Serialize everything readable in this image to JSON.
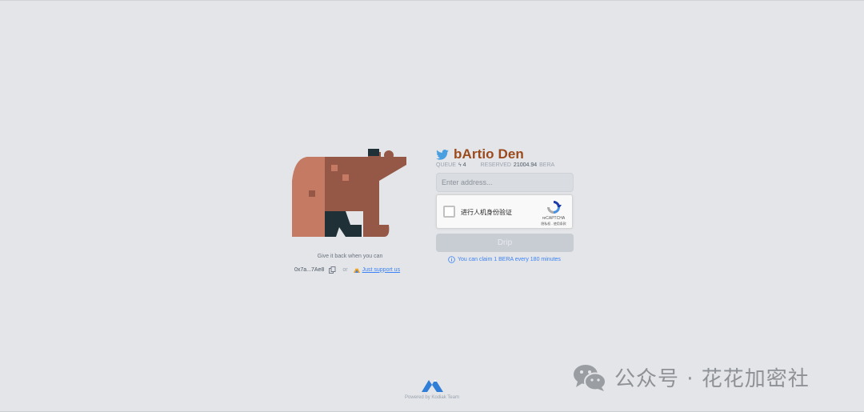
{
  "colors": {
    "background": "#e3e5e8",
    "title": "#9a4a1c",
    "link": "#3b82f6",
    "bear_light": "#c47a63",
    "bear_mid": "#955847",
    "bear_dark": "#1f3137",
    "button_disabled": "#c8ccd3"
  },
  "left": {
    "give_back_text": "Give it back when you can",
    "address": "0x7a...7Ae8",
    "copy_icon": "copy-icon",
    "or_text": "or",
    "support_label": "Just support us"
  },
  "faucet": {
    "title": "bArtio Den",
    "title_icon": "twitter-bird-icon",
    "queue_label": "QUEUE",
    "queue_value": "4",
    "reserved_label": "RESERVED",
    "reserved_value": "21004.94",
    "reserved_unit": "BERA",
    "address_placeholder": "Enter address...",
    "captcha_label": "进行人机身份验证",
    "captcha_brand": "reCAPTCHA",
    "captcha_terms": "隐私权 - 使用条款",
    "drip_label": "Drip",
    "info_text": "You can claim 1 BERA every 180 minutes"
  },
  "footer": {
    "powered_by": "Powered by Kodiak Team"
  },
  "watermark": {
    "text": "公众号 · 花花加密社"
  }
}
